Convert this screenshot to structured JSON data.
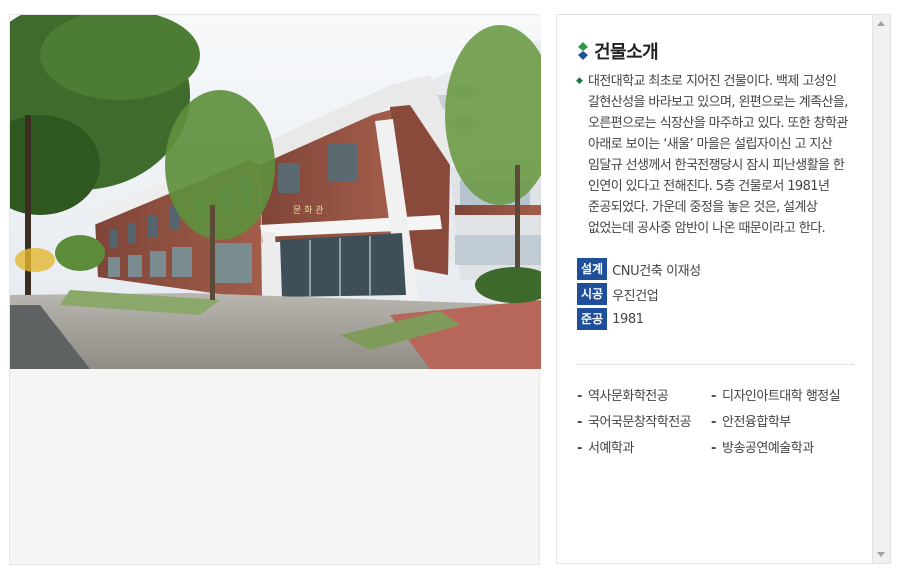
{
  "photo": {
    "icon": "building-photo",
    "building_sign": "문 화 관"
  },
  "info": {
    "title": "건물소개",
    "title_icon": "diamond-double-icon",
    "description": "대전대학교 최초로 지어진 건물이다. 백제 고성인 갈현산성을 바라보고 있으며, 왼편으로는 계족산을, 오른편으로는 식장산을 마주하고 있다. 또한 창학관 아래로 보이는 ‘새울’ 마을은 설립자이신 고 지산 임달규 선생께서 한국전쟁당시 잠시 피난생활을 한 인연이 있다고 전해진다. 5층 건물로서 1981년 준공되었다. 가운데 중정을 놓은 것은, 설계상 없었는데 공사중 암반이 나온 때문이라고 한다.",
    "bullet_color": "#1e7a3c",
    "facts": [
      {
        "label": "설계",
        "value": "CNU건축 이재성"
      },
      {
        "label": "시공",
        "value": "우진건업"
      },
      {
        "label": "준공",
        "value": "1981"
      }
    ],
    "label_color": "#1f4f9b",
    "departments": [
      "역사문화학전공",
      "디자인아트대학 행정실",
      "국어국문창작학전공",
      "안전융합학부",
      "서예학과",
      "방송공연예술학과"
    ]
  }
}
